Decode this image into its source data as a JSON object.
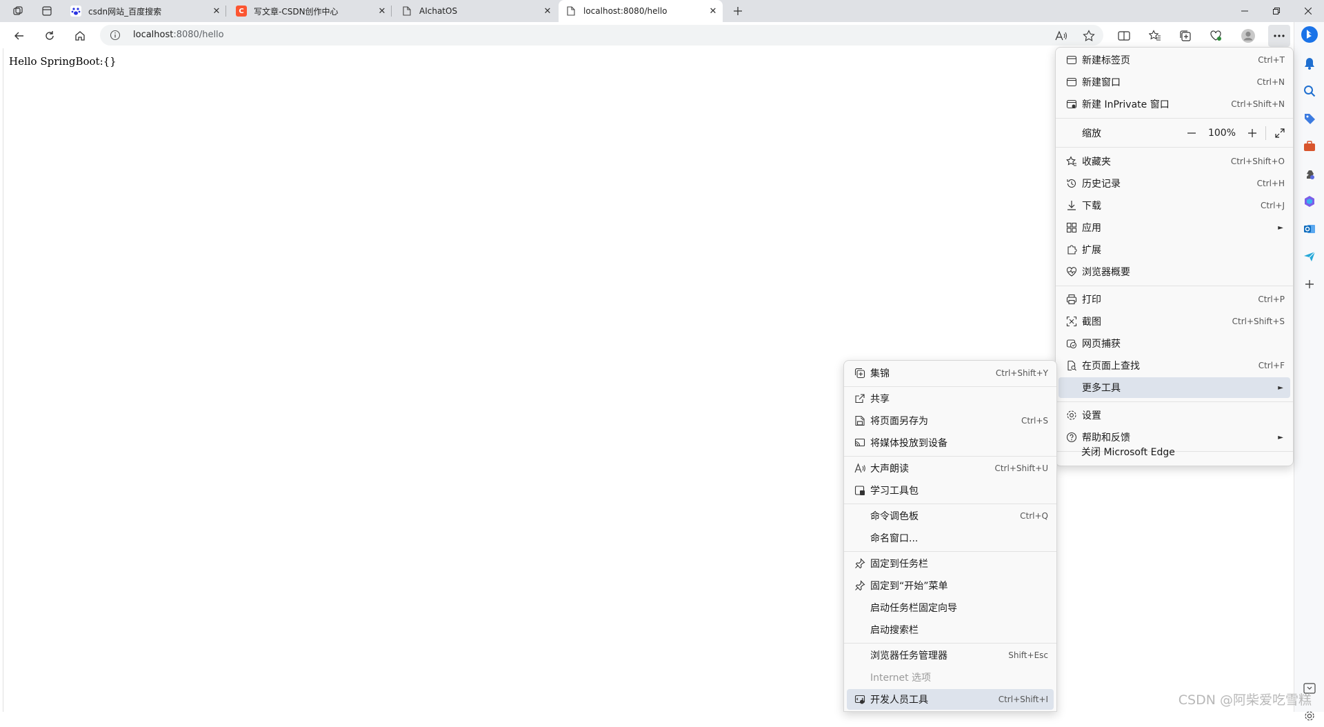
{
  "tabs": [
    {
      "title": "csdn网站_百度搜索",
      "favicon": "baidu-paw-icon"
    },
    {
      "title": "写文章-CSDN创作中心",
      "favicon": "csdn-logo-icon"
    },
    {
      "title": "AIchatOS",
      "favicon": "page-icon"
    },
    {
      "title": "localhost:8080/hello",
      "favicon": "page-icon"
    }
  ],
  "address": {
    "host": "localhost",
    "path": ":8080/hello"
  },
  "page": {
    "text": "Hello SpringBoot:{}"
  },
  "main_menu": {
    "items": [
      {
        "label": "新建标签页",
        "shortcut": "Ctrl+T"
      },
      {
        "label": "新建窗口",
        "shortcut": "Ctrl+N"
      },
      {
        "label": "新建 InPrivate 窗口",
        "shortcut": "Ctrl+Shift+N"
      }
    ],
    "zoom": {
      "label": "缩放",
      "value": "100%",
      "minus": "—",
      "plus": "+"
    },
    "items2": [
      {
        "label": "收藏夹",
        "shortcut": "Ctrl+Shift+O"
      },
      {
        "label": "历史记录",
        "shortcut": "Ctrl+H"
      },
      {
        "label": "下载",
        "shortcut": "Ctrl+J"
      },
      {
        "label": "应用",
        "shortcut": ""
      },
      {
        "label": "扩展",
        "shortcut": ""
      },
      {
        "label": "浏览器概要",
        "shortcut": ""
      }
    ],
    "items3": [
      {
        "label": "打印",
        "shortcut": "Ctrl+P"
      },
      {
        "label": "截图",
        "shortcut": "Ctrl+Shift+S"
      },
      {
        "label": "网页捕获",
        "shortcut": ""
      },
      {
        "label": "在页面上查找",
        "shortcut": "Ctrl+F"
      },
      {
        "label": "更多工具",
        "shortcut": ""
      }
    ],
    "items4": [
      {
        "label": "设置",
        "shortcut": ""
      },
      {
        "label": "帮助和反馈",
        "shortcut": ""
      }
    ],
    "close": {
      "label": "关闭 Microsoft Edge"
    }
  },
  "sub_menu": {
    "items": [
      {
        "label": "集锦",
        "shortcut": "Ctrl+Shift+Y"
      },
      {
        "label": "共享",
        "shortcut": ""
      },
      {
        "label": "将页面另存为",
        "shortcut": "Ctrl+S"
      },
      {
        "label": "将媒体投放到设备",
        "shortcut": ""
      },
      {
        "label": "大声朗读",
        "shortcut": "Ctrl+Shift+U"
      },
      {
        "label": "学习工具包",
        "shortcut": ""
      },
      {
        "label": "命令调色板",
        "shortcut": "Ctrl+Q"
      },
      {
        "label": "命名窗口...",
        "shortcut": ""
      },
      {
        "label": "固定到任务栏",
        "shortcut": ""
      },
      {
        "label": "固定到“开始”菜单",
        "shortcut": ""
      },
      {
        "label": "启动任务栏固定向导",
        "shortcut": ""
      },
      {
        "label": "启动搜索栏",
        "shortcut": ""
      },
      {
        "label": "浏览器任务管理器",
        "shortcut": "Shift+Esc"
      },
      {
        "label": "Internet 选项",
        "shortcut": ""
      },
      {
        "label": "开发人员工具",
        "shortcut": "Ctrl+Shift+I"
      }
    ]
  },
  "watermark": "CSDN @阿柴爱吃雪糕",
  "colors": {
    "accent": "#0067c0",
    "highlight": "#dde3ec",
    "tabstrip": "#dfe1e5"
  }
}
